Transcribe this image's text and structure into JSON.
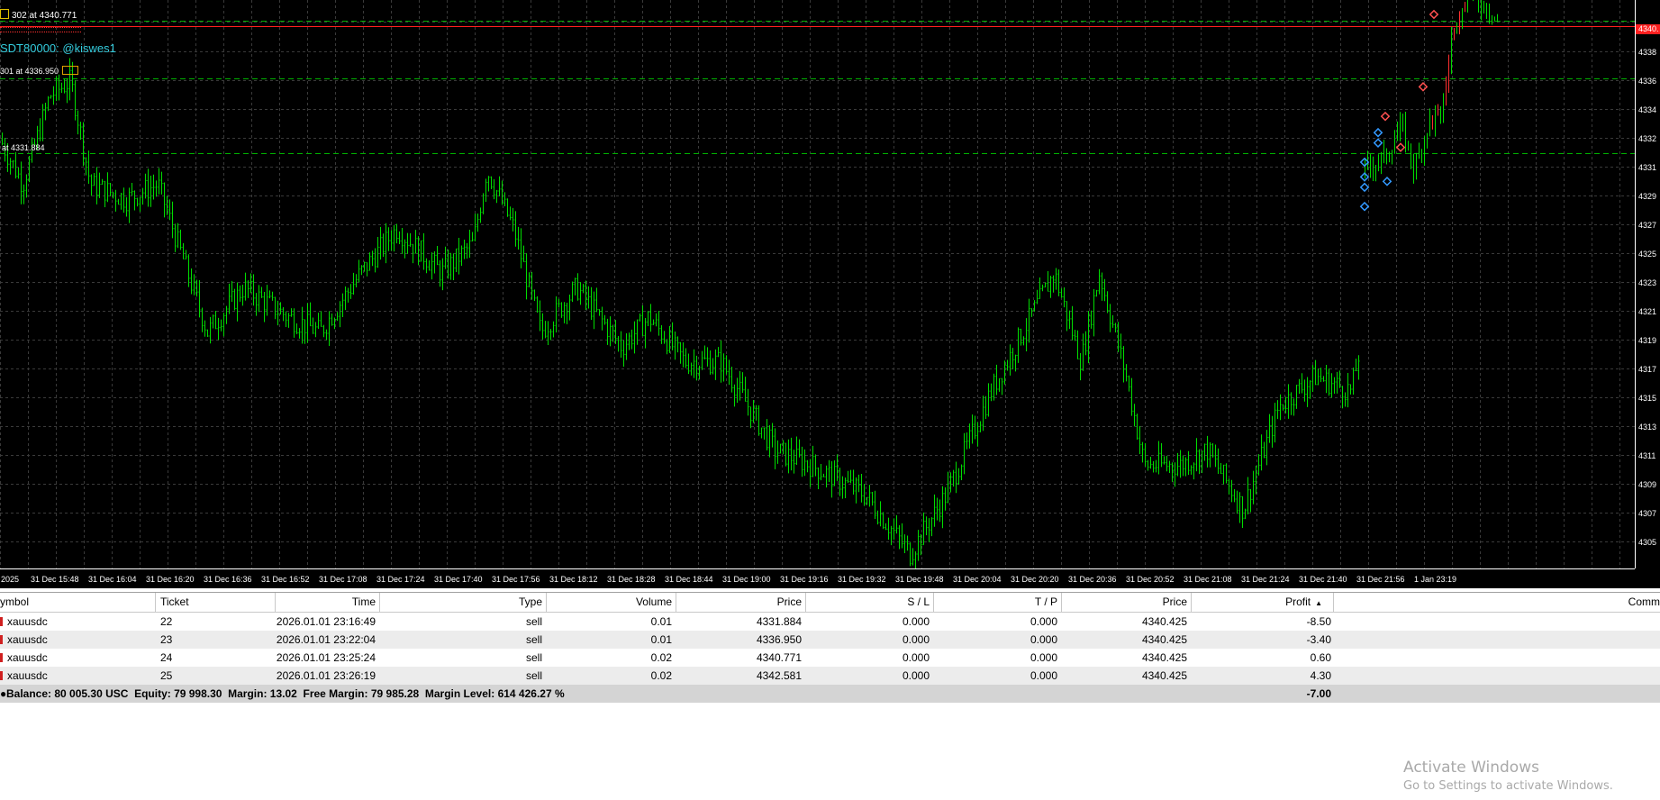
{
  "chart": {
    "symbol_overlays": {
      "line1": "302 at 4340.771",
      "line2": "SDT80000: @kiswes1",
      "line3": "301 at 4336.950",
      "line4": "at 4331.884"
    },
    "current_price_tag": "4340.",
    "y_ticks": [
      "4338",
      "4336",
      "4334",
      "4332",
      "4331",
      "4329",
      "4327",
      "4325",
      "4323",
      "4321",
      "4319",
      "4317",
      "4315",
      "4313",
      "4311",
      "4309",
      "4307",
      "4305"
    ],
    "x_ticks": [
      "2025",
      "31 Dec 15:48",
      "31 Dec 16:04",
      "31 Dec 16:20",
      "31 Dec 16:36",
      "31 Dec 16:52",
      "31 Dec 17:08",
      "31 Dec 17:24",
      "31 Dec 17:40",
      "31 Dec 17:56",
      "31 Dec 18:12",
      "31 Dec 18:28",
      "31 Dec 18:44",
      "31 Dec 19:00",
      "31 Dec 19:16",
      "31 Dec 19:32",
      "31 Dec 19:48",
      "31 Dec 20:04",
      "31 Dec 20:20",
      "31 Dec 20:36",
      "31 Dec 20:52",
      "31 Dec 21:08",
      "31 Dec 21:24",
      "31 Dec 21:40",
      "31 Dec 21:56",
      "1 Jan 23:19"
    ],
    "colors": {
      "background": "#000000",
      "grid": "#3a3a3a",
      "candle": "#00dd00",
      "axis_text": "#ffffff",
      "bid_line": "#ff2020",
      "order_line": "#00b000"
    }
  },
  "trades": {
    "columns": [
      "ymbol",
      "Ticket",
      "Time",
      "Type",
      "Volume",
      "Price",
      "S / L",
      "T / P",
      "Price",
      "Profit",
      "Comm"
    ],
    "rows": [
      {
        "symbol": "xauusdc",
        "ticket": "22",
        "time": "2026.01.01 23:16:49",
        "type": "sell",
        "volume": "0.01",
        "price": "4331.884",
        "sl": "0.000",
        "tp": "0.000",
        "price2": "4340.425",
        "profit": "-8.50"
      },
      {
        "symbol": "xauusdc",
        "ticket": "23",
        "time": "2026.01.01 23:22:04",
        "type": "sell",
        "volume": "0.01",
        "price": "4336.950",
        "sl": "0.000",
        "tp": "0.000",
        "price2": "4340.425",
        "profit": "-3.40"
      },
      {
        "symbol": "xauusdc",
        "ticket": "24",
        "time": "2026.01.01 23:25:24",
        "type": "sell",
        "volume": "0.02",
        "price": "4340.771",
        "sl": "0.000",
        "tp": "0.000",
        "price2": "4340.425",
        "profit": "0.60"
      },
      {
        "symbol": "xauusdc",
        "ticket": "25",
        "time": "2026.01.01 23:26:19",
        "type": "sell",
        "volume": "0.02",
        "price": "4342.581",
        "sl": "0.000",
        "tp": "0.000",
        "price2": "4340.425",
        "profit": "4.30"
      }
    ],
    "summary": "Balance: 80 005.30 USC  Equity: 79 998.30  Margin: 13.02  Free Margin: 79 985.28  Margin Level: 614 426.27 %",
    "total_profit": "-7.00"
  },
  "watermark": {
    "line1": "Activate Windows",
    "line2": "Go to Settings to activate Windows."
  }
}
